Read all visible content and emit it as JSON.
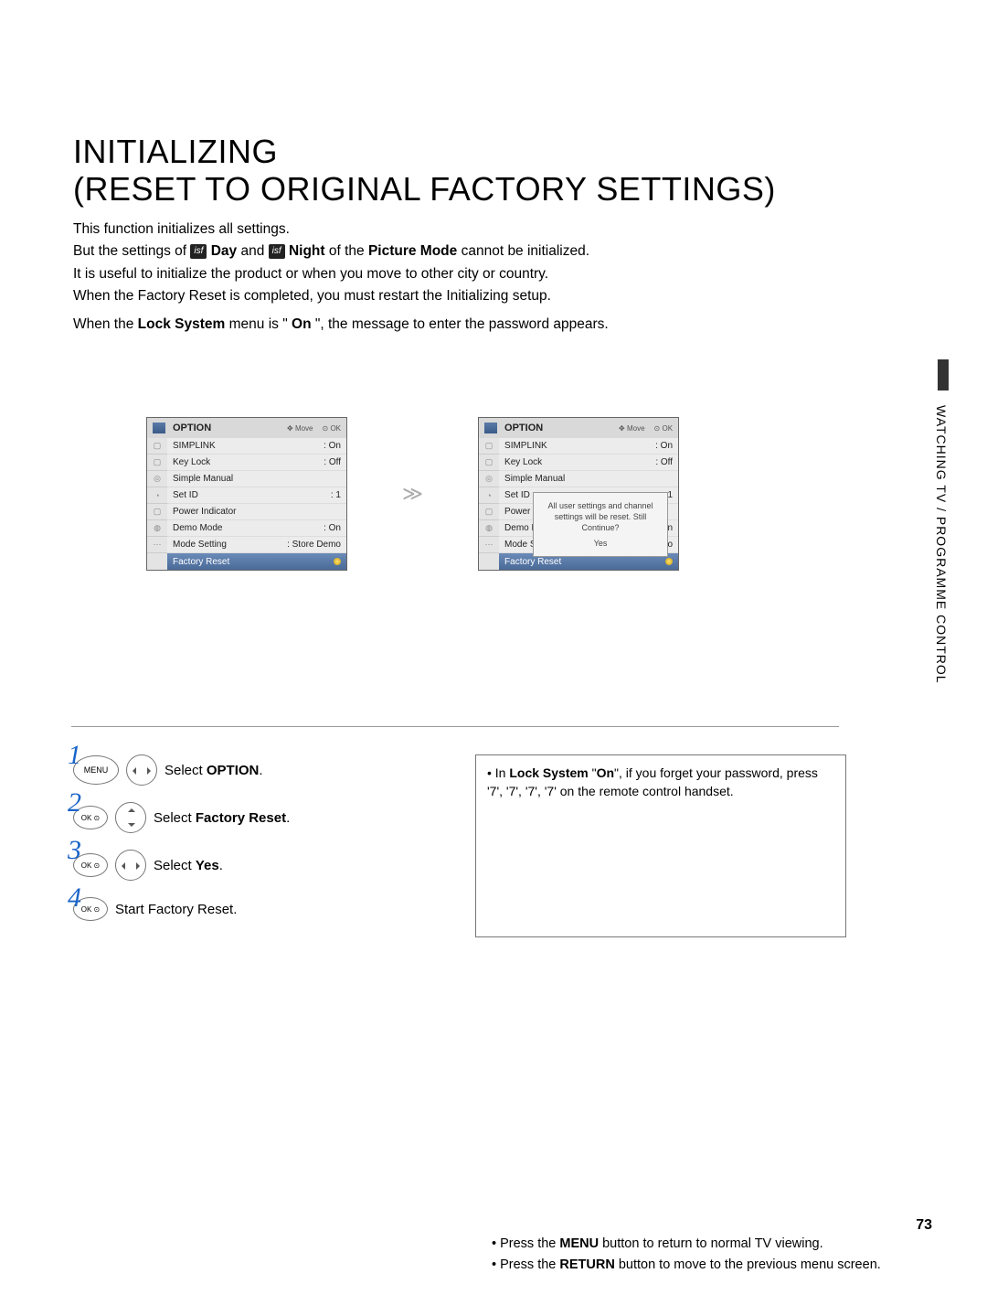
{
  "title_line1": "INITIALIZING",
  "title_line2": "(RESET TO ORIGINAL FACTORY SETTINGS)",
  "intro": {
    "l1": " This function initializes all settings.",
    "l2a": "But the settings of ",
    "badge_day": "isf",
    "day": "Day",
    "l2b": " and ",
    "badge_night": "isf",
    "night": "Night",
    "l2c": " of the ",
    "pm": "Picture Mode",
    "l2d": " cannot be initialized.",
    "l3": "It is useful to initialize the product or when you move to other city or country.",
    "l4": "When the Factory Reset is completed, you must restart the Initializing setup.",
    "l5a": "When the ",
    "ls": "Lock System",
    "l5b": " menu is \"",
    "on": "On",
    "l5c": "\", the message to enter the password appears."
  },
  "side_section": "WATCHING TV / PROGRAMME CONTROL",
  "page_number": "73",
  "osd": {
    "title": "OPTION",
    "hint_move": "Move",
    "hint_ok": "OK",
    "items": [
      {
        "k": "SIMPLINK",
        "v": ": On"
      },
      {
        "k": "Key Lock",
        "v": ": Off"
      },
      {
        "k": "Simple Manual",
        "v": ""
      },
      {
        "k": "Set ID",
        "v": ": 1"
      },
      {
        "k": "Power Indicator",
        "v": ""
      },
      {
        "k": "Demo Mode",
        "v": ": On"
      },
      {
        "k": "Mode Setting",
        "v": ": Store Demo"
      },
      {
        "k": "Factory Reset",
        "v": ""
      }
    ],
    "dialog_l1": "All user settings and channel",
    "dialog_l2": "settings will be reset. Still",
    "dialog_l3": "Continue?",
    "dialog_yes": "Yes"
  },
  "steps": {
    "s1_btn": "MENU",
    "s1_txt_a": "Select ",
    "s1_txt_b": "OPTION",
    "s1_txt_c": ".",
    "s2_btn": "OK\n⊙",
    "s2_txt_a": "Select ",
    "s2_txt_b": "Factory Reset",
    "s2_txt_c": ".",
    "s3_btn": "OK\n⊙",
    "s3_txt_a": "Select ",
    "s3_txt_b": "Yes",
    "s3_txt_c": ".",
    "s4_btn": "OK\n⊙",
    "s4_txt": "Start Factory Reset."
  },
  "tip": {
    "a": "• In ",
    "b": "Lock System",
    "c": " \"",
    "d": "On",
    "e": "\", if you forget your password, press '7', '7', '7', '7' on the remote control handset."
  },
  "bottom": {
    "a1": "• Press the ",
    "a2": "MENU",
    "a3": " button to return to normal TV viewing.",
    "b1": "• Press the ",
    "b2": "RETURN",
    "b3": " button to move to the previous menu screen."
  }
}
